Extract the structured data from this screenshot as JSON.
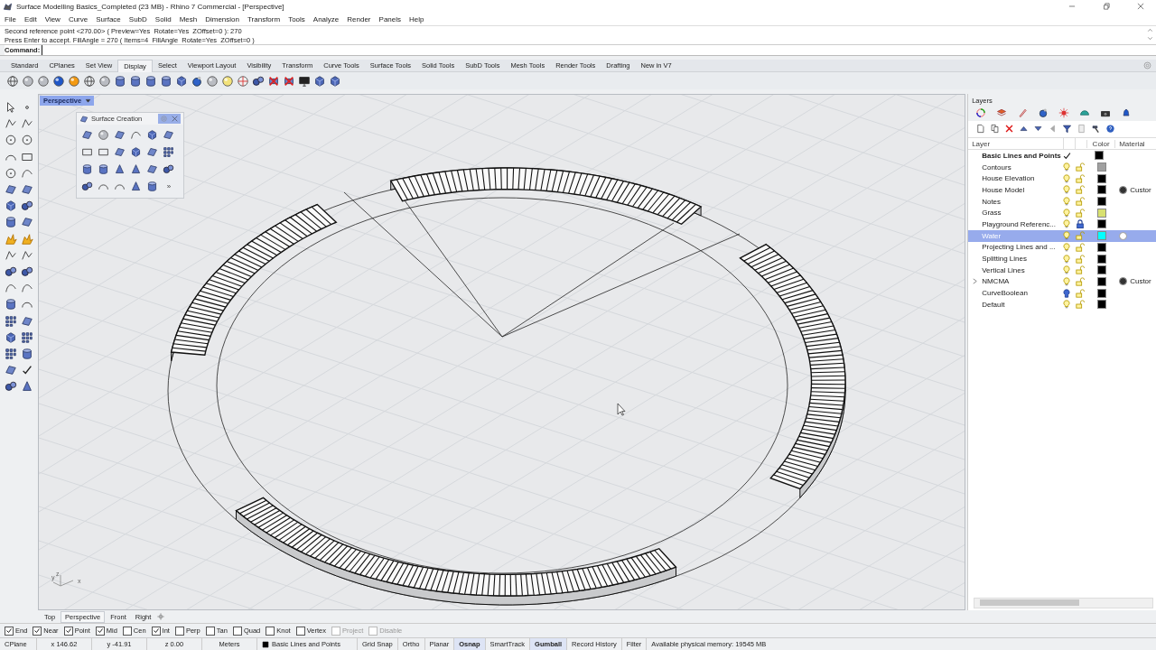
{
  "window": {
    "title": "Surface Modelling Basics_Completed (23 MB) - Rhino 7 Commercial - [Perspective]"
  },
  "menu": [
    "File",
    "Edit",
    "View",
    "Curve",
    "Surface",
    "SubD",
    "Solid",
    "Mesh",
    "Dimension",
    "Transform",
    "Tools",
    "Analyze",
    "Render",
    "Panels",
    "Help"
  ],
  "command_history": [
    "Second reference point <270.00> ( Preview=Yes  Rotate=Yes  ZOffset=0 ): 270",
    "Press Enter to accept. FillAngle = 270 ( Items=4  FillAngle  Rotate=Yes  ZOffset=0 )"
  ],
  "command": {
    "label": "Command:"
  },
  "toolbar_tabs": [
    {
      "label": "Standard",
      "selected": false
    },
    {
      "label": "CPlanes",
      "selected": false
    },
    {
      "label": "Set View",
      "selected": false
    },
    {
      "label": "Display",
      "selected": true
    },
    {
      "label": "Select",
      "selected": false
    },
    {
      "label": "Viewport Layout",
      "selected": false
    },
    {
      "label": "Visibility",
      "selected": false
    },
    {
      "label": "Transform",
      "selected": false
    },
    {
      "label": "Curve Tools",
      "selected": false
    },
    {
      "label": "Surface Tools",
      "selected": false
    },
    {
      "label": "Solid Tools",
      "selected": false
    },
    {
      "label": "SubD Tools",
      "selected": false
    },
    {
      "label": "Mesh Tools",
      "selected": false
    },
    {
      "label": "Render Tools",
      "selected": false
    },
    {
      "label": "Drafting",
      "selected": false
    },
    {
      "label": "New in V7",
      "selected": false
    }
  ],
  "viewport": {
    "title": "Perspective",
    "axis_labels": [
      "z",
      "y",
      "x"
    ]
  },
  "surface_creation": {
    "title": "Surface Creation",
    "more": "»"
  },
  "layers_panel": {
    "title": "Layers",
    "columns": [
      "Layer",
      "Color",
      "Material"
    ],
    "layers": [
      {
        "name": "Basic Lines and Points",
        "current": true,
        "selected": false,
        "expandable": false,
        "color": "#000000"
      },
      {
        "name": "Contours",
        "current": false,
        "selected": false,
        "expandable": false,
        "visible": true,
        "locked": false,
        "color": "#a0a0a0"
      },
      {
        "name": "House Elevation",
        "current": false,
        "selected": false,
        "expandable": false,
        "visible": true,
        "locked": false,
        "color": "#000000"
      },
      {
        "name": "House Model",
        "current": false,
        "selected": false,
        "expandable": false,
        "visible": true,
        "locked": false,
        "color": "#000000",
        "material": {
          "color": "#333333",
          "name": "Custor"
        }
      },
      {
        "name": "Notes",
        "current": false,
        "selected": false,
        "expandable": false,
        "visible": true,
        "locked": false,
        "color": "#000000"
      },
      {
        "name": "Grass",
        "current": false,
        "selected": false,
        "expandable": false,
        "visible": true,
        "locked": false,
        "color": "#d8e070"
      },
      {
        "name": "Playground Referenc...",
        "current": false,
        "selected": false,
        "expandable": false,
        "visible": true,
        "locked": true,
        "color": "#000000"
      },
      {
        "name": "Water",
        "current": false,
        "selected": true,
        "expandable": false,
        "visible": true,
        "locked": false,
        "color": "#00ffff",
        "material": {
          "color": "#ffffff"
        }
      },
      {
        "name": "Projecting Lines and ...",
        "current": false,
        "selected": false,
        "expandable": false,
        "visible": true,
        "locked": false,
        "color": "#000000"
      },
      {
        "name": "Splitting Lines",
        "current": false,
        "selected": false,
        "expandable": false,
        "visible": true,
        "locked": false,
        "color": "#000000"
      },
      {
        "name": "Vertical Lines",
        "current": false,
        "selected": false,
        "expandable": false,
        "visible": true,
        "locked": false,
        "color": "#000000"
      },
      {
        "name": "NMCMA",
        "current": false,
        "selected": false,
        "expandable": true,
        "visible": true,
        "locked": false,
        "color": "#000000",
        "material": {
          "color": "#333333",
          "name": "Custor"
        }
      },
      {
        "name": "CurveBoolean",
        "current": false,
        "selected": false,
        "expandable": false,
        "visible": false,
        "locked": false,
        "color": "#000000"
      },
      {
        "name": "Default",
        "current": false,
        "selected": false,
        "expandable": false,
        "visible": true,
        "locked": false,
        "color": "#000000"
      }
    ]
  },
  "viewport_tabs": [
    {
      "label": "Top",
      "selected": false
    },
    {
      "label": "Perspective",
      "selected": true
    },
    {
      "label": "Front",
      "selected": false
    },
    {
      "label": "Right",
      "selected": false
    }
  ],
  "osnaps": [
    {
      "label": "End",
      "checked": true,
      "disabled": false
    },
    {
      "label": "Near",
      "checked": true,
      "disabled": false
    },
    {
      "label": "Point",
      "checked": true,
      "disabled": false
    },
    {
      "label": "Mid",
      "checked": true,
      "disabled": false
    },
    {
      "label": "Cen",
      "checked": false,
      "disabled": false
    },
    {
      "label": "Int",
      "checked": true,
      "disabled": false
    },
    {
      "label": "Perp",
      "checked": false,
      "disabled": false
    },
    {
      "label": "Tan",
      "checked": false,
      "disabled": false
    },
    {
      "label": "Quad",
      "checked": false,
      "disabled": false
    },
    {
      "label": "Knot",
      "checked": false,
      "disabled": false
    },
    {
      "label": "Vertex",
      "checked": false,
      "disabled": false
    },
    {
      "label": "Project",
      "checked": false,
      "disabled": true
    },
    {
      "label": "Disable",
      "checked": false,
      "disabled": true
    }
  ],
  "status_bar": {
    "cplane": "CPlane",
    "x": "x 146.62",
    "y": "y -41.91",
    "z": "z 0.00",
    "units": "Meters",
    "layer": "Basic Lines and Points",
    "toggles": [
      {
        "label": "Grid Snap",
        "on": false
      },
      {
        "label": "Ortho",
        "on": false
      },
      {
        "label": "Planar",
        "on": false
      },
      {
        "label": "Osnap",
        "on": true
      },
      {
        "label": "SmartTrack",
        "on": false
      },
      {
        "label": "Gumball",
        "on": true
      },
      {
        "label": "Record History",
        "on": false
      },
      {
        "label": "Filter",
        "on": false
      }
    ],
    "memory": "Available physical memory: 19545 MB"
  }
}
